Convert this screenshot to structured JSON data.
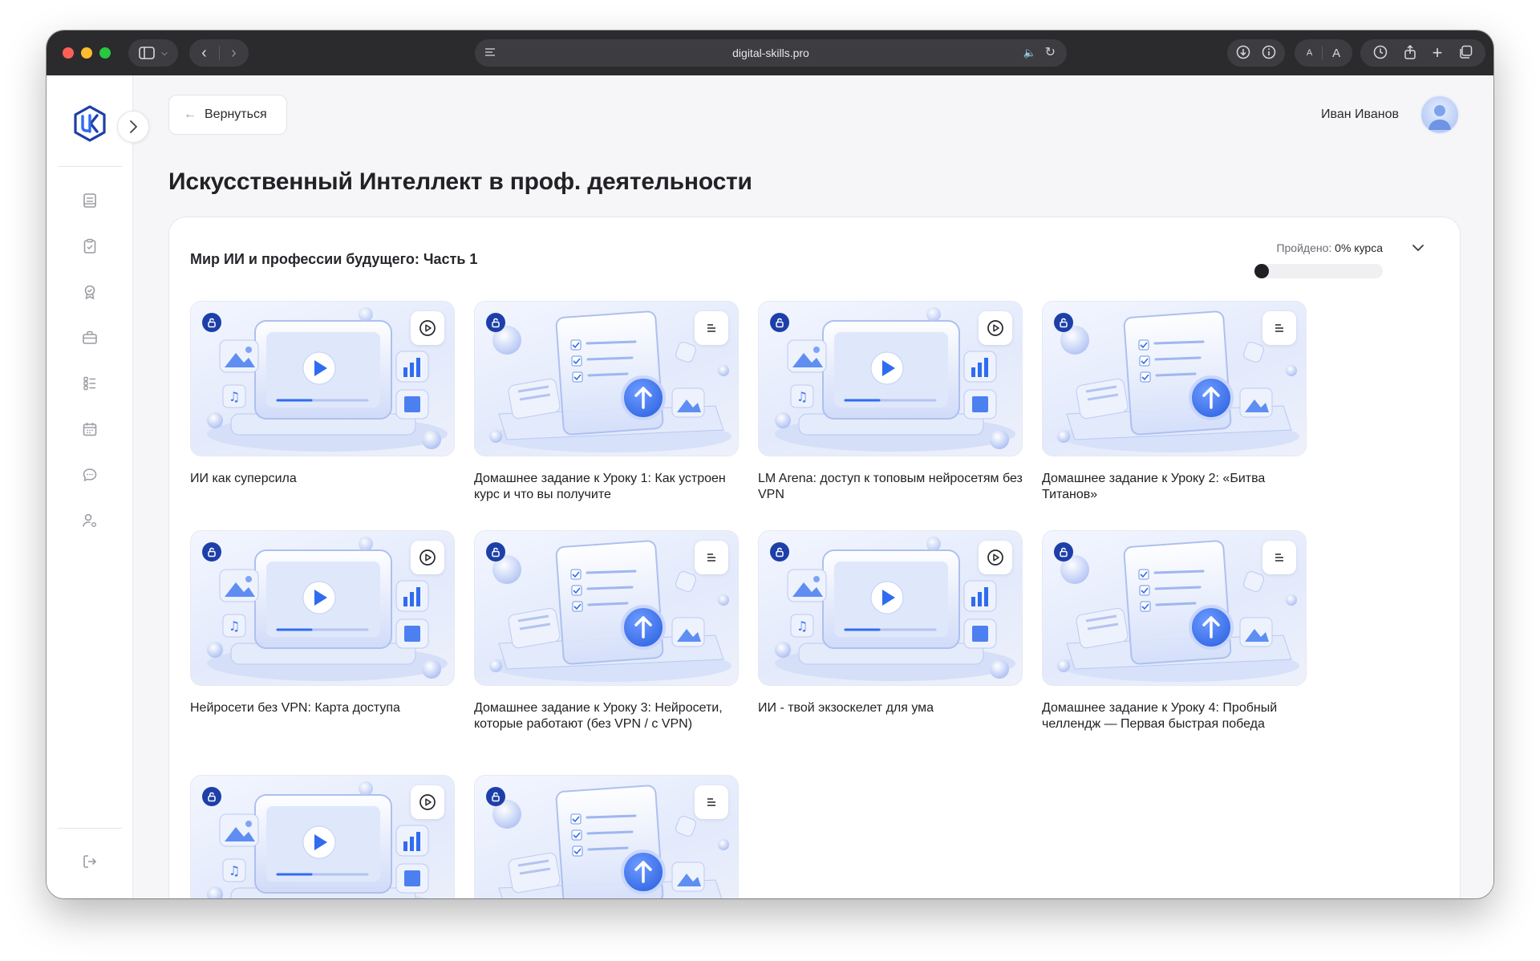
{
  "browser": {
    "url": "digital-skills.pro"
  },
  "header": {
    "back_label": "Вернуться",
    "user_name": "Иван Иванов"
  },
  "page_title": "Искусственный Интеллект в проф. деятельности",
  "section": {
    "title": "Мир ИИ и профессии будущего: Часть 1",
    "progress_prefix": "Пройдено:",
    "progress_value": "0% курса",
    "progress_fraction": 0
  },
  "sidebar": {
    "items": [
      {
        "icon": "book-icon"
      },
      {
        "icon": "clipboard-icon"
      },
      {
        "icon": "badge-icon"
      },
      {
        "icon": "briefcase-icon"
      },
      {
        "icon": "list-icon"
      },
      {
        "icon": "calendar-icon"
      },
      {
        "icon": "chat-icon"
      },
      {
        "icon": "user-settings-icon"
      }
    ],
    "logout_icon": "logout-icon"
  },
  "lessons": [
    {
      "title": "ИИ как суперсила",
      "type": "video",
      "icon": "play-icon"
    },
    {
      "title": "Домашнее задание к Уроку 1: Как устроен курс и что вы получите",
      "type": "homework",
      "icon": "text-icon"
    },
    {
      "title": "LM Arena: доступ к топовым нейросетям без VPN",
      "type": "video",
      "icon": "play-icon"
    },
    {
      "title": "Домашнее задание к Уроку 2: «Битва Титанов»",
      "type": "homework",
      "icon": "text-icon"
    },
    {
      "title": "Нейросети без VPN: Карта доступа",
      "type": "video",
      "icon": "play-icon"
    },
    {
      "title": "Домашнее задание к Уроку 3: Нейросети, которые работают (без VPN / с VPN)",
      "type": "homework",
      "icon": "text-icon"
    },
    {
      "title": "ИИ - твой экзоскелет для ума",
      "type": "video",
      "icon": "play-icon"
    },
    {
      "title": "Домашнее задание к Уроку 4: Пробный челлендж — Первая быстрая победа",
      "type": "homework",
      "icon": "text-icon"
    },
    {
      "title": "",
      "type": "video",
      "icon": "play-icon"
    },
    {
      "title": "",
      "type": "homework",
      "icon": "text-icon"
    }
  ],
  "colors": {
    "accent": "#2f6cf0",
    "badge": "#1d3fa8",
    "dark": "#1f1f24"
  }
}
